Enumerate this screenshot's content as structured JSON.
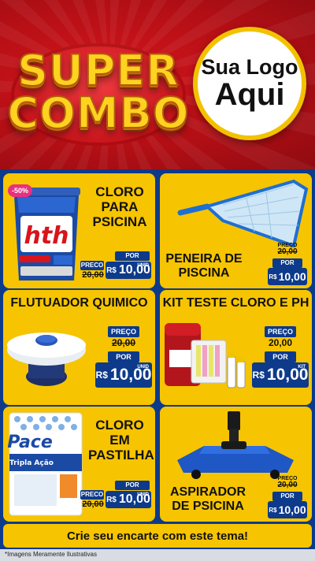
{
  "header": {
    "title_line1": "SUPER",
    "title_line2": "COMBO",
    "logo_line1": "Sua Logo",
    "logo_line2": "Aqui"
  },
  "products": [
    {
      "title": "CLORO PARA PSICINA",
      "badge": "-50%",
      "was_label": "PRECO",
      "was_value": "20,00",
      "now_label": "POR",
      "currency": "R$",
      "now_value": "10,00",
      "unit": "UNID",
      "icon": "chlorine-bucket-hth",
      "brand": "hth"
    },
    {
      "title": "PENEIRA DE PISCINA",
      "was_label": "PREÇO",
      "was_value": "20,00",
      "now_label": "POR",
      "currency": "R$",
      "now_value": "10,00",
      "icon": "pool-skimmer-net"
    },
    {
      "title": "FLUTUADOR QUIMICO",
      "was_label": "PREÇO",
      "was_value": "20,00",
      "now_label": "POR",
      "currency": "R$",
      "now_value": "10,00",
      "unit": "UNID",
      "icon": "chemical-floater"
    },
    {
      "title": "KIT TESTE CLORO E PH",
      "was_label": "PREÇO",
      "was_value": "20,00",
      "now_label": "POR",
      "currency": "R$",
      "now_value": "10,00",
      "unit": "KIT",
      "icon": "test-kit"
    },
    {
      "title": "CLORO EM PASTILHA",
      "was_label": "PRECO",
      "was_value": "20,00",
      "now_label": "POR",
      "currency": "R$",
      "now_value": "10,00",
      "unit": "UNID",
      "icon": "chlorine-tablets-bag",
      "brand": "Pace",
      "bag_line1": "Tripla Ação"
    },
    {
      "title": "ASPIRADOR DE PSICINA",
      "was_label": "PREÇO",
      "was_value": "20,00",
      "now_label": "POR",
      "currency": "R$",
      "now_value": "10,00",
      "icon": "pool-vacuum-head"
    }
  ],
  "cta": "Crie seu encarte com este tema!",
  "footnote": "*Imagens Meramente Ilustrativas",
  "colors": {
    "red": "#c9141b",
    "yellow": "#f6c400",
    "blue": "#0d3a8a",
    "gold": "#ffd21f"
  }
}
